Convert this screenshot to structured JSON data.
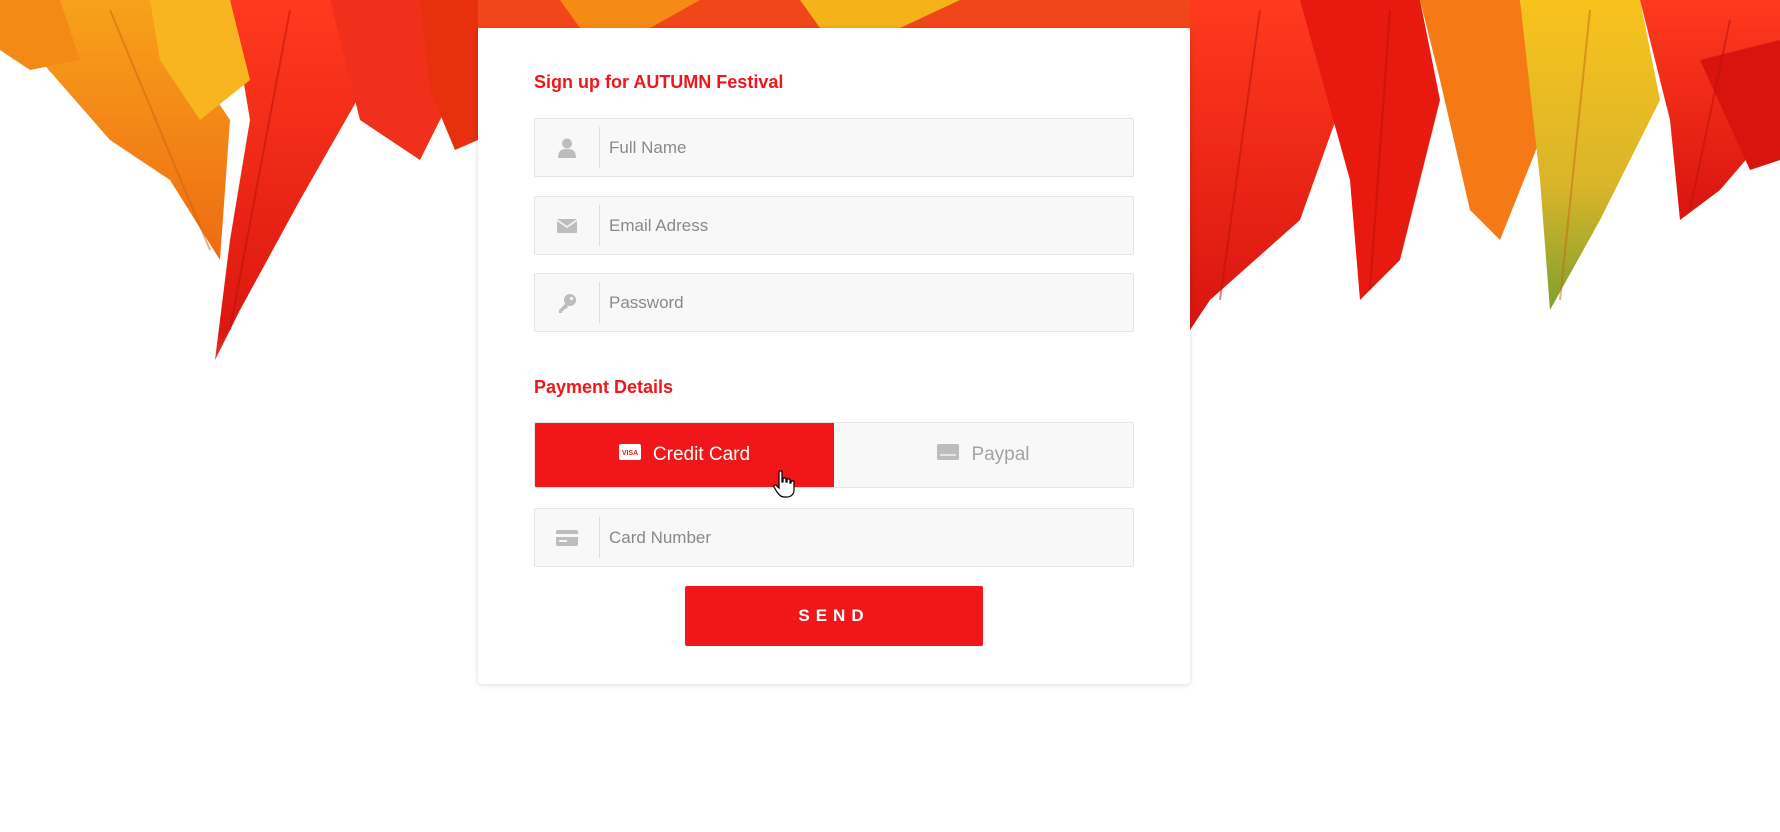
{
  "form": {
    "title": "Sign up for AUTUMN Festival",
    "fields": {
      "full_name": {
        "placeholder": "Full Name",
        "icon": "user-icon"
      },
      "email": {
        "placeholder": "Email Adress",
        "icon": "envelope-icon"
      },
      "password": {
        "placeholder": "Password",
        "icon": "key-icon"
      }
    }
  },
  "payment": {
    "title": "Payment Details",
    "methods": [
      {
        "label": "Credit Card",
        "icon": "visa-card-icon",
        "selected": true
      },
      {
        "label": "Paypal",
        "icon": "paypal-card-icon",
        "selected": false
      }
    ],
    "card_number": {
      "placeholder": "Card Number",
      "icon": "credit-card-icon"
    }
  },
  "send_label": "SEND",
  "colors": {
    "accent": "#f0161a",
    "field_bg": "#f8f8f8",
    "icon_gray": "#bdbdbd"
  }
}
